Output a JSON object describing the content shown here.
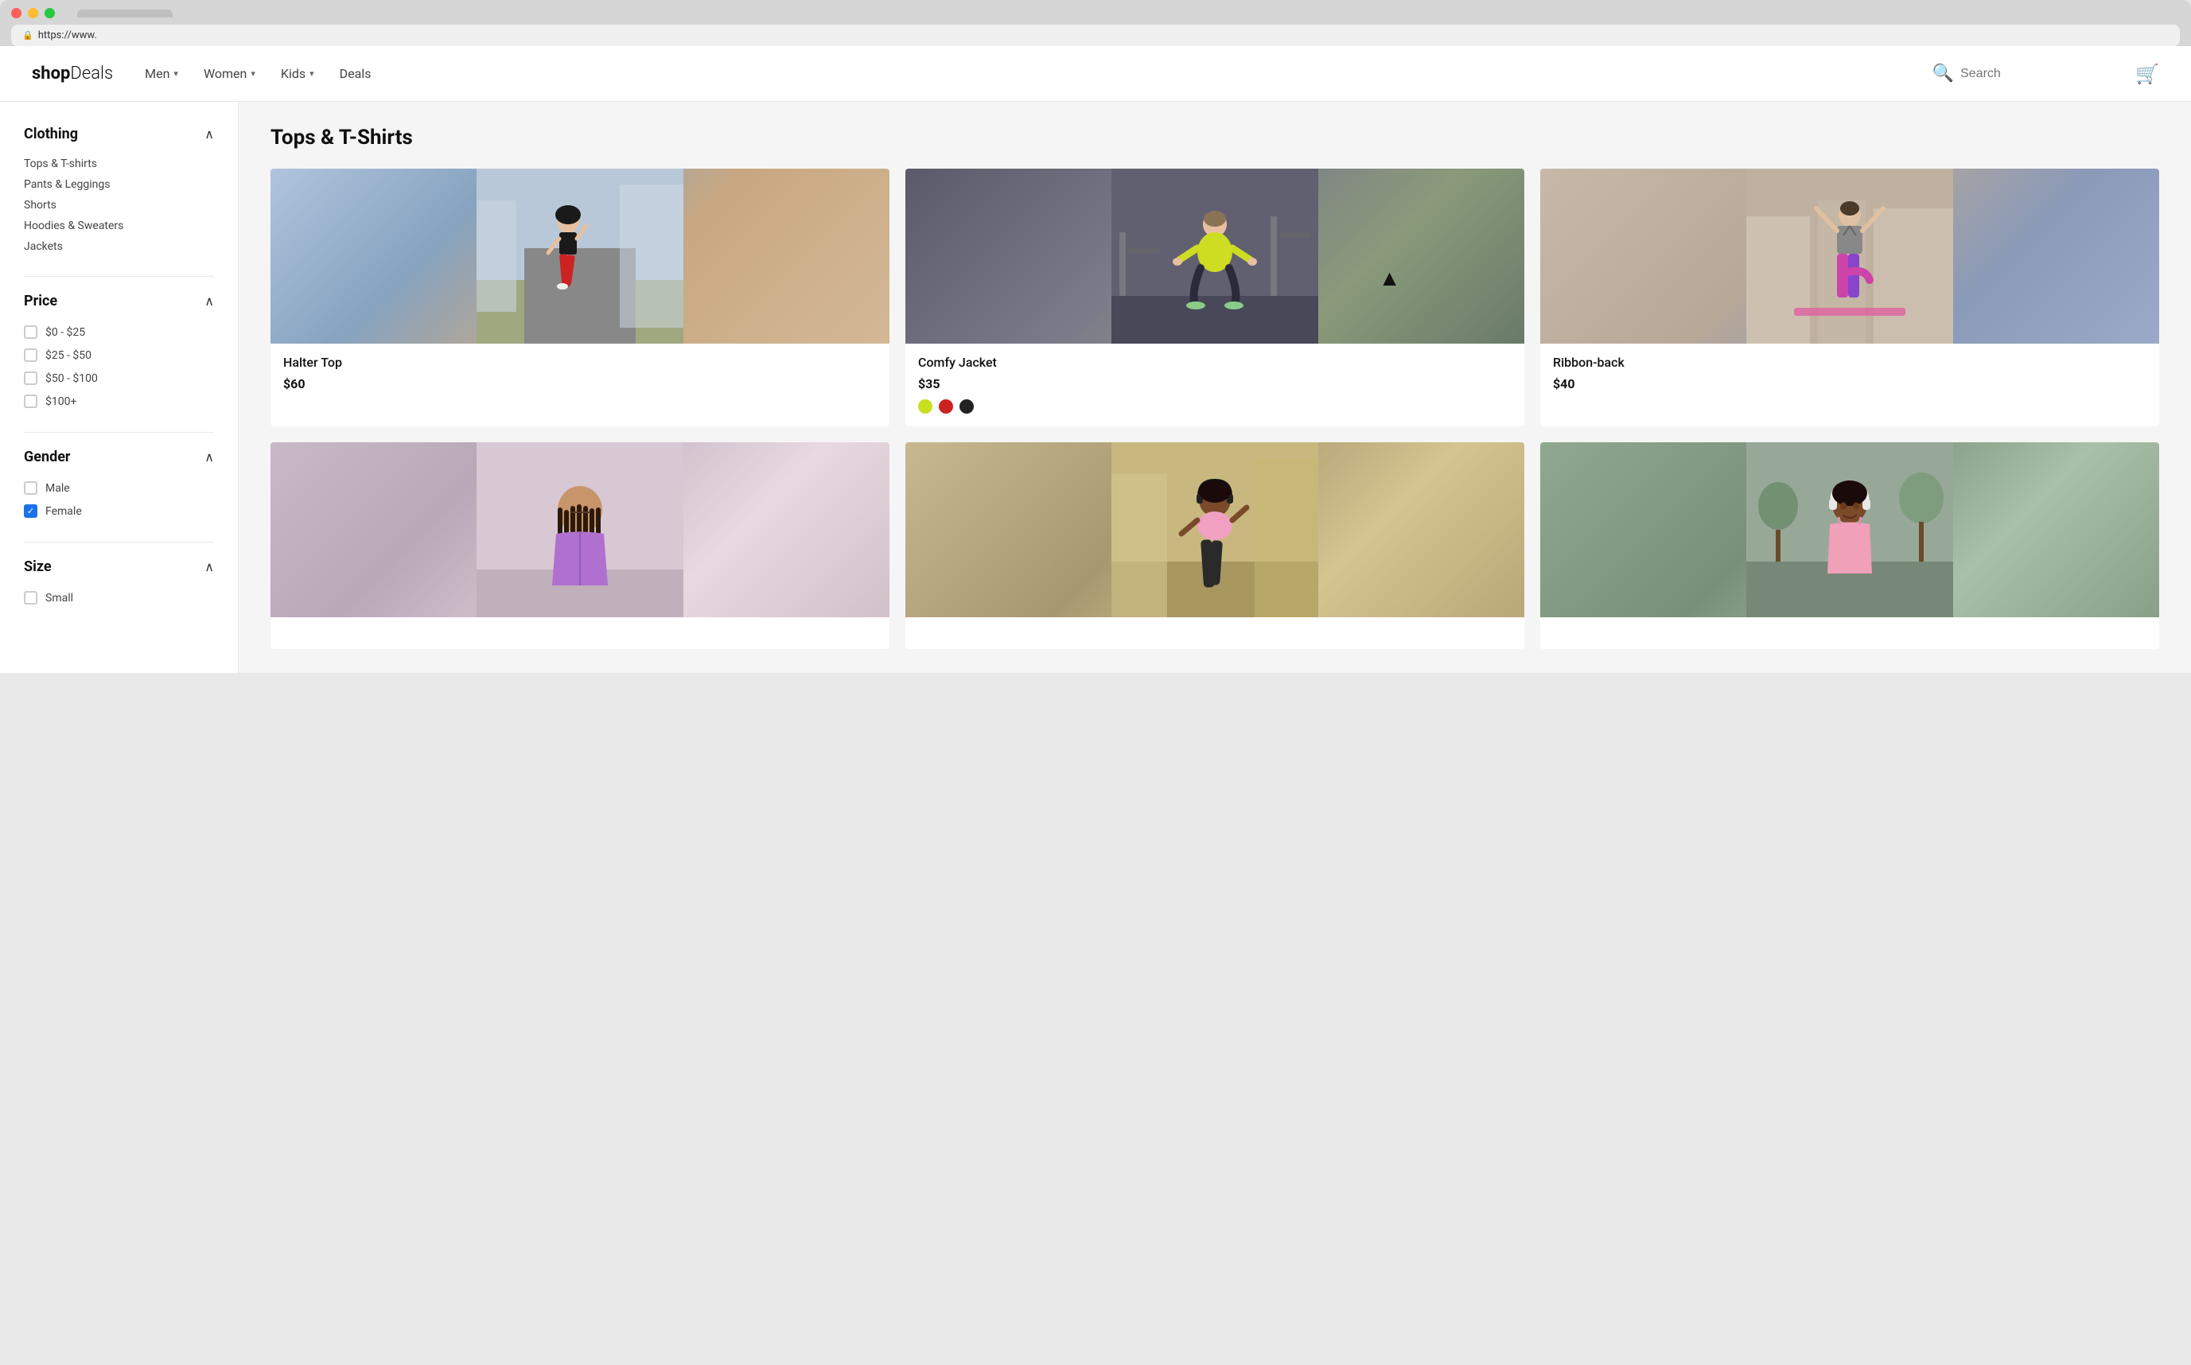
{
  "browser": {
    "url": "https://www.",
    "tab_label": ""
  },
  "header": {
    "logo": "shopDeals",
    "logo_light": "Deals",
    "nav": [
      {
        "label": "Men",
        "has_dropdown": true
      },
      {
        "label": "Women",
        "has_dropdown": true
      },
      {
        "label": "Kids",
        "has_dropdown": true
      },
      {
        "label": "Deals",
        "has_dropdown": false
      }
    ],
    "search_placeholder": "Search",
    "cart_label": "cart"
  },
  "sidebar": {
    "clothing_label": "Clothing",
    "clothing_items": [
      {
        "label": "Tops & T-shirts"
      },
      {
        "label": "Pants & Leggings"
      },
      {
        "label": "Shorts"
      },
      {
        "label": "Hoodies & Sweaters"
      },
      {
        "label": "Jackets"
      }
    ],
    "price_label": "Price",
    "price_items": [
      {
        "label": "$0 - $25",
        "checked": false
      },
      {
        "label": "$25 - $50",
        "checked": false
      },
      {
        "label": "$50 - $100",
        "checked": false
      },
      {
        "label": "$100+",
        "checked": false
      }
    ],
    "gender_label": "Gender",
    "gender_items": [
      {
        "label": "Male",
        "checked": false
      },
      {
        "label": "Female",
        "checked": true
      }
    ],
    "size_label": "Size",
    "size_items": [
      {
        "label": "Small",
        "checked": false
      }
    ]
  },
  "main": {
    "section_title": "Tops & T-Shirts",
    "products": [
      {
        "name": "Halter Top",
        "price": "$60",
        "colors": [],
        "img_class": "img-runner"
      },
      {
        "name": "Comfy Jacket",
        "price": "$35",
        "colors": [
          "#c8e020",
          "#cc2222",
          "#222222"
        ],
        "img_class": "img-gym",
        "has_cursor": true
      },
      {
        "name": "Ribbon-back",
        "price": "$40",
        "colors": [],
        "img_class": "img-yoga"
      },
      {
        "name": "",
        "price": "",
        "colors": [],
        "img_class": "img-purple"
      },
      {
        "name": "",
        "price": "",
        "colors": [],
        "img_class": "img-outdoor"
      },
      {
        "name": "",
        "price": "",
        "colors": [],
        "img_class": "img-city"
      }
    ]
  }
}
